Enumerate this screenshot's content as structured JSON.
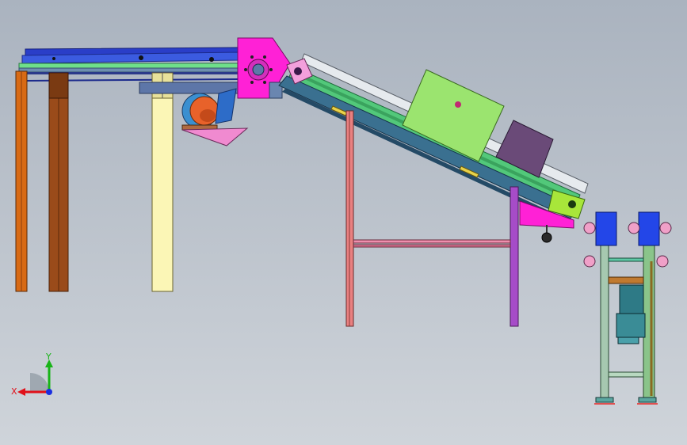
{
  "viewport": {
    "background_top": "#aab3bf",
    "background_bottom": "#cfd4da"
  },
  "triad": {
    "x_label": "X",
    "y_label": "Y",
    "x_color": "#e0101a",
    "y_color": "#18b418",
    "z_color": "#1a2ee0"
  },
  "colors": {
    "magenta_housing": "#ff21d6",
    "orange_leg": "#d86a14",
    "brown_leg": "#9a4b1a",
    "cream_leg": "#fbf6b6",
    "incline_frame": "#3a7090",
    "green_belt": "#52c87a",
    "light_green_box": "#9be46f",
    "purple_box": "#6a4a78",
    "support_pink": "#e98080",
    "motor_orange": "#e8622a",
    "motor_blue": "#3a8fd0",
    "blue_bearing": "#2346e8",
    "gearbox_teal": "#2e7a86"
  }
}
